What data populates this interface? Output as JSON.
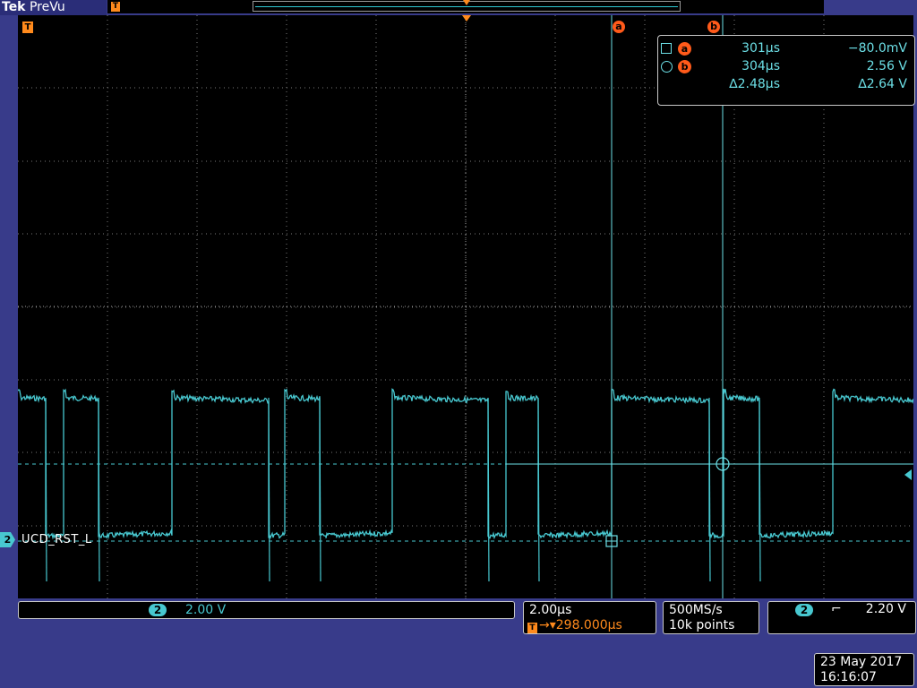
{
  "header": {
    "brand": "Tek",
    "mode": "PreVu",
    "trigger_icon": "T"
  },
  "screen": {
    "trigger_marker": "T",
    "cursor_a_label": "a",
    "cursor_b_label": "b",
    "channel": {
      "number": "2",
      "label": "UCD_RST_L",
      "color": "#48c8d0"
    }
  },
  "cursor_readout": {
    "row_a": {
      "badge": "a",
      "time": "301µs",
      "value": "−80.0mV"
    },
    "row_b": {
      "badge": "b",
      "time": "304µs",
      "value": "2.56 V"
    },
    "row_delta": {
      "time": "∆2.48µs",
      "value": "∆2.64 V"
    }
  },
  "status": {
    "channel_scale": {
      "channel": "2",
      "value": "2.00 V"
    },
    "timebase": {
      "per_div": "2.00µs",
      "trigger_icon": "T",
      "delay": "→▾298.000µs"
    },
    "acquisition": {
      "rate": "500MS/s",
      "points": "10k points"
    },
    "trigger": {
      "channel": "2",
      "edge": "⌐",
      "level": "2.20 V"
    },
    "datetime": {
      "date": "23 May 2017",
      "time": "16:16:07"
    }
  },
  "colors": {
    "trace": "#48c8d0",
    "cursor": "#6cdfe6",
    "marker": "#ff8a1c",
    "badge": "#ff5a1a",
    "frame": "#383b8a"
  }
}
